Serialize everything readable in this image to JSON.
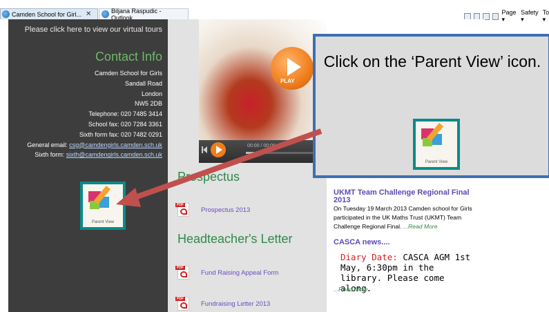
{
  "browser": {
    "tabs": [
      {
        "label": "Camden School for Girl...",
        "close": "✕"
      },
      {
        "label": "Biljana Raspudic - Outlook..."
      }
    ],
    "tools": {
      "page": "Page ▾",
      "safety": "Safety ▾",
      "tools": "Tools ▾",
      "help": "?"
    }
  },
  "left": {
    "tours_text": "Please click here to view our virtual tours",
    "contact_title": "Contact Info",
    "address": [
      "Camden School for Girls",
      "Sandall Road",
      "London",
      "NW5 2DB"
    ],
    "telephone": "Telephone: 020 7485 3414",
    "school_fax": "School fax: 020 7284 3361",
    "sixth_fax": "Sixth form fax: 020 7482 0291",
    "general_email_label": "General email: ",
    "general_email": "csg@camdengirls.camden.sch.uk",
    "sixth_email_label": "Sixth form: ",
    "sixth_email": "sixth@camdengirls.camden.sch.uk",
    "parent_view_label": "Parent View"
  },
  "video": {
    "play_label": "PLAY",
    "time": "00:00 / 00:00"
  },
  "middle": {
    "prospectus_title": "Prospectus",
    "prospectus_link": "Prospectus 2013",
    "headteacher_title": "Headteacher's Letter",
    "doc2": "Fund Raising Appeal Form",
    "doc3": "Fundraising Letter 2013"
  },
  "news": {
    "ukmt_title": "UKMT Team Challenge Regional Final 2013",
    "ukmt_text": "On Tuesday 19 March 2013 Camden school for Girls participated in the UK Maths Trust (UKMT) Team Challenge Regional Final. ",
    "read_more": "...Read More",
    "casca_title": "CASCA news....",
    "diary_label": "Diary Date:",
    "diary_text": " CASCA AGM 1st May, 6:30pm in the library. Please come along.",
    "read_more_2": "...Read More"
  },
  "callout": {
    "text": "Click on the ‘Parent View’ icon.",
    "icon_label": "Parent View"
  },
  "colors": {
    "accent_green": "#2e8a48",
    "link_purple": "#6a4ec0",
    "callout_border": "#3e6fb0",
    "arrow": "#c0504d"
  }
}
